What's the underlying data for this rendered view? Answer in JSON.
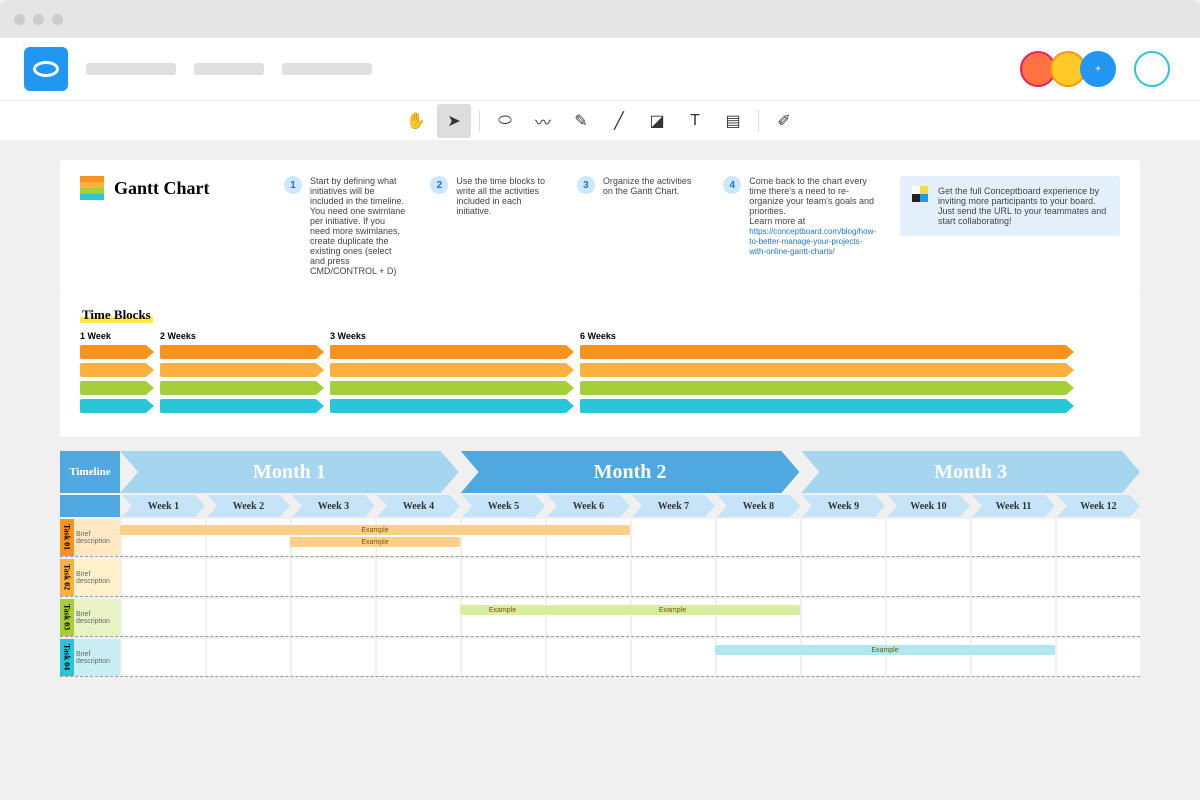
{
  "title": "Gantt Chart",
  "steps": [
    {
      "n": "1",
      "text": "Start by defining what initiatives will be included in the timeline. You need one swimlane per initiative. If you need more swimlanes, create duplicate the existing ones (select and press CMD/CONTROL + D)"
    },
    {
      "n": "2",
      "text": "Use the time blocks to write all the activities included in each initiative."
    },
    {
      "n": "3",
      "text": "Organize the activities on the Gantt Chart."
    },
    {
      "n": "4",
      "text": "Come back to the chart every time there's a need to re-organize your team's goals and priorities.",
      "link_label": "Learn more at",
      "link": "https://conceptboard.com/blog/how-to-better-manage-your-projects-with-online-gantt-charts/"
    }
  ],
  "promo": "Get the full Conceptboard experience by inviting more participants to your board. Just send the URL to your teammates and start collaborating!",
  "time_blocks_title": "Time Blocks",
  "durations": [
    "1 Week",
    "2 Weeks",
    "3 Weeks",
    "6 Weeks"
  ],
  "bar_colors": [
    "#f7931e",
    "#fbb040",
    "#a6ce39",
    "#29c5d8"
  ],
  "timeline_label": "Timeline",
  "months": [
    {
      "label": "Month 1",
      "color": "#a6d5f0"
    },
    {
      "label": "Month 2",
      "color": "#4fa8e0"
    },
    {
      "label": "Month 3",
      "color": "#a6d5f0"
    }
  ],
  "weeks": [
    "Week 1",
    "Week 2",
    "Week 3",
    "Week 4",
    "Week 5",
    "Week 6",
    "Week 7",
    "Week 8",
    "Week 9",
    "Week 10",
    "Week 11",
    "Week 12"
  ],
  "tasks": [
    {
      "name": "Task 01",
      "tab": "#f7931e",
      "desc_bg": "#ffe8c2",
      "desc": "Brief description",
      "items": [
        {
          "label": "Example",
          "start": 0,
          "span": 6,
          "color": "#fcd08a"
        },
        {
          "label": "Example",
          "start": 2,
          "span": 2,
          "color": "#fcd08a",
          "row": 1
        }
      ]
    },
    {
      "name": "Task 02",
      "tab": "#fbb040",
      "desc_bg": "#fff0cc",
      "desc": "Brief description",
      "items": []
    },
    {
      "name": "Task 03",
      "tab": "#a6ce39",
      "desc_bg": "#e8f2c4",
      "desc": "Brief description",
      "items": [
        {
          "label": "Example",
          "start": 4,
          "span": 1,
          "color": "#d5eea0"
        },
        {
          "label": "Example",
          "start": 5,
          "span": 3,
          "color": "#d5eea0"
        }
      ]
    },
    {
      "name": "Task 04",
      "tab": "#29c5d8",
      "desc_bg": "#c9eff4",
      "desc": "Brief description",
      "items": [
        {
          "label": "Example",
          "start": 7,
          "span": 4,
          "color": "#b0e8f0"
        }
      ]
    }
  ],
  "chart_data": {
    "type": "bar",
    "title": "Gantt Chart",
    "xlabel": "Week",
    "ylabel": "Task",
    "categories": [
      "Week 1",
      "Week 2",
      "Week 3",
      "Week 4",
      "Week 5",
      "Week 6",
      "Week 7",
      "Week 8",
      "Week 9",
      "Week 10",
      "Week 11",
      "Week 12"
    ],
    "series": [
      {
        "name": "Task 01 – Example",
        "start": 1,
        "end": 6
      },
      {
        "name": "Task 01 – Example",
        "start": 3,
        "end": 4
      },
      {
        "name": "Task 03 – Example",
        "start": 5,
        "end": 5
      },
      {
        "name": "Task 03 – Example",
        "start": 6,
        "end": 8
      },
      {
        "name": "Task 04 – Example",
        "start": 8,
        "end": 11
      }
    ]
  }
}
